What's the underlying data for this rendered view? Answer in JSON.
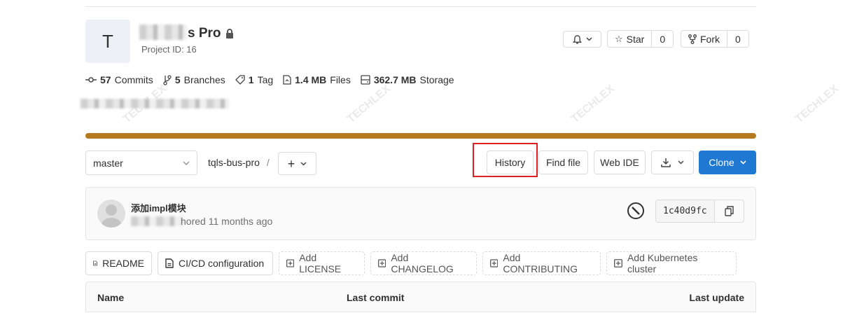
{
  "project": {
    "avatar_letter": "T",
    "name_suffix": "s Pro",
    "project_id": "Project ID: 16"
  },
  "header_actions": {
    "star_label": "Star",
    "star_count": "0",
    "fork_label": "Fork",
    "fork_count": "0"
  },
  "stats": [
    {
      "value": "57",
      "label": "Commits",
      "icon": "commit-icon"
    },
    {
      "value": "5",
      "label": "Branches",
      "icon": "branch-icon"
    },
    {
      "value": "1",
      "label": "Tag",
      "icon": "tag-icon"
    },
    {
      "value": "1.4 MB",
      "label": "Files",
      "icon": "file-icon"
    },
    {
      "value": "362.7 MB",
      "label": "Storage",
      "icon": "storage-icon"
    }
  ],
  "repo_nav": {
    "branch": "master",
    "path": "tqls-bus-pro",
    "separator": "/",
    "history": "History",
    "find_file": "Find file",
    "web_ide": "Web IDE",
    "clone": "Clone"
  },
  "last_commit": {
    "title": "添加impl模块",
    "meta": "hored 11 months ago",
    "sha": "1c40d9fc"
  },
  "quick_buttons": [
    {
      "label": "README",
      "dashed": false,
      "icon": "doc-icon"
    },
    {
      "label": "CI/CD configuration",
      "dashed": false,
      "icon": "doc-icon"
    },
    {
      "label": "Add LICENSE",
      "dashed": true,
      "icon": "plus-square-icon"
    },
    {
      "label": "Add CHANGELOG",
      "dashed": true,
      "icon": "plus-square-icon"
    },
    {
      "label": "Add CONTRIBUTING",
      "dashed": true,
      "icon": "plus-square-icon"
    },
    {
      "label": "Add Kubernetes cluster",
      "dashed": true,
      "icon": "plus-square-icon"
    }
  ],
  "table": {
    "col_name": "Name",
    "col_last_commit": "Last commit",
    "col_last_update": "Last update"
  },
  "colors": {
    "progress": "#b5791e",
    "clone_bg": "#1f78d1",
    "highlight": "#e02020"
  }
}
